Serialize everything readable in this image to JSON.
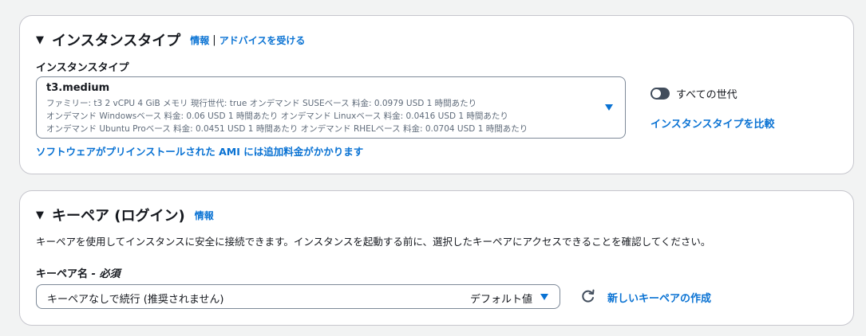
{
  "instance_type_panel": {
    "title": "インスタンスタイプ",
    "info_link": "情報",
    "separator": "|",
    "advice_link": "アドバイスを受ける",
    "field_label": "インスタンスタイプ",
    "selected": {
      "name": "t3.medium",
      "line1": "ファミリー: t3    2 vCPU    4 GiB メモリ    現行世代: true    オンデマンド SUSEベース 料金: 0.0979 USD 1 時間あたり",
      "line2": "オンデマンド Windowsベース 料金: 0.06 USD 1 時間あたり     オンデマンド Linuxベース 料金: 0.0416 USD 1 時間あたり",
      "line3": "オンデマンド Ubuntu Proベース 料金: 0.0451 USD 1 時間あたり     オンデマンド RHELベース 料金: 0.0704 USD 1 時間あたり"
    },
    "all_generations_label": "すべての世代",
    "all_generations_enabled": false,
    "compare_link": "インスタンスタイプを比較",
    "ami_note_link": "ソフトウェアがプリインストールされた AMI には追加料金がかかります"
  },
  "key_pair_panel": {
    "title": "キーペア (ログイン)",
    "info_link": "情報",
    "description": "キーペアを使用してインスタンスに安全に接続できます。インスタンスを起動する前に、選択したキーペアにアクセスできることを確認してください。",
    "field_label": "キーペア名",
    "required_suffix": "- 必須",
    "selected_value": "キーペアなしで続行 (推奨されません)",
    "default_tag": "デフォルト値",
    "create_link": "新しいキーペアの作成"
  },
  "colors": {
    "link": "#0972d3",
    "border": "#c6c6cd",
    "background": "#f2f3f3"
  }
}
